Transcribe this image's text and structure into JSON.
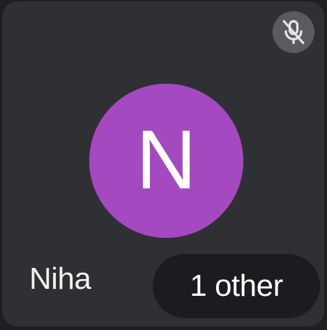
{
  "tile": {
    "participant": {
      "name": "Niha",
      "initial": "N",
      "avatar_color": "#a549c0"
    },
    "mic_status_icon": "mic-off-icon",
    "others_label": "1 other"
  }
}
